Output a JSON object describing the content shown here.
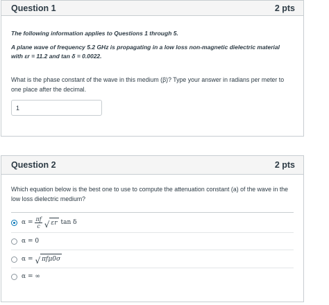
{
  "q1": {
    "title": "Question 1",
    "points": "2 pts",
    "intro": "The following information applies to Questions 1 through 5.",
    "setup_line1": "A plane wave of frequency 5.2 GHz is propagating in a low loss non-magnetic dielectric material",
    "setup_line2": "with εr = 11.2 and tan δ = 0.0022.",
    "prompt": "What is the phase constant of the wave in this medium (β)? Type your answer in radians per meter to one place after the decimal.",
    "answer_value": "1"
  },
  "q2": {
    "title": "Question 2",
    "points": "2 pts",
    "prompt": "Which equation below is the best one to use to compute the attenuation constant (a) of the wave in the low loss dielectric medium?",
    "options": [
      {
        "lhs": "α =",
        "num": "πf",
        "den": "c",
        "rad": "εr",
        "tail": "tan δ",
        "selected": true
      },
      {
        "text": "α = 0",
        "selected": false
      },
      {
        "lhs": "α =",
        "rad": "πfμ0σ",
        "selected": false
      },
      {
        "text": "α = ∞",
        "selected": false
      }
    ]
  }
}
